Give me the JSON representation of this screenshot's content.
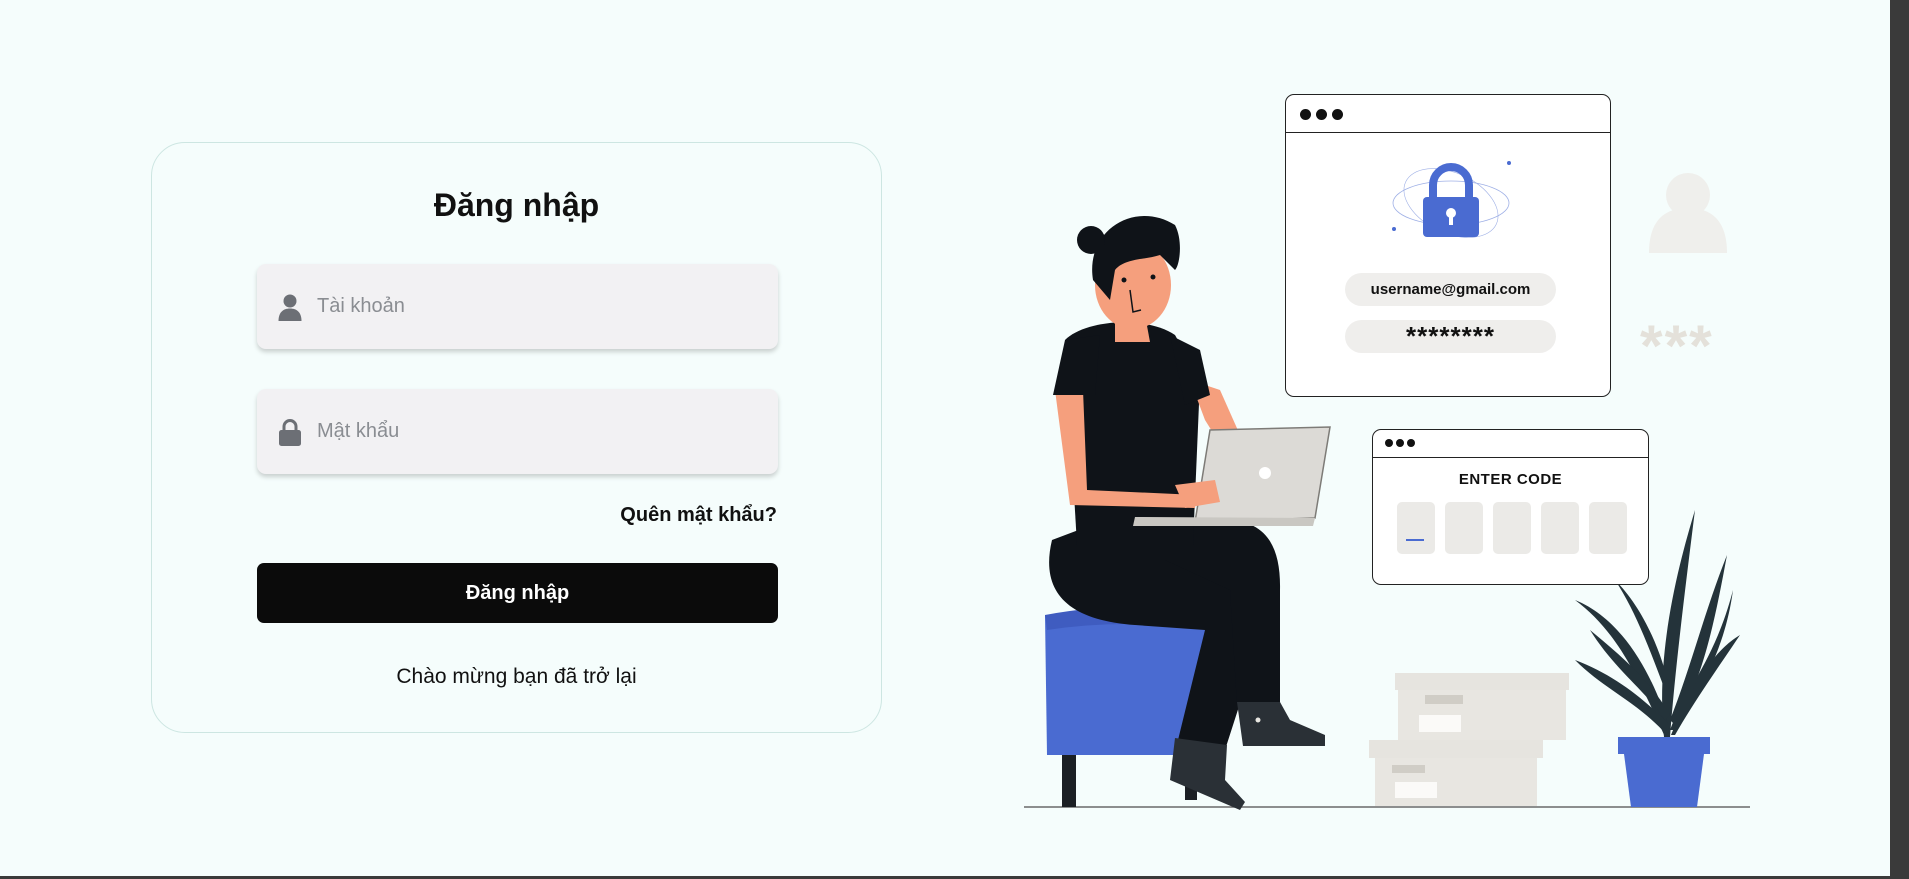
{
  "login": {
    "title": "Đăng nhập",
    "username_placeholder": "Tài khoản",
    "password_placeholder": "Mật khẩu",
    "forgot_password": "Quên mật khẩu?",
    "submit_label": "Đăng nhập",
    "welcome_text": "Chào mừng bạn đã trở lại"
  },
  "illustration": {
    "email_text": "username@gmail.com",
    "password_mask": "********",
    "enter_code_label": "ENTER CODE",
    "decor_stars": "***"
  },
  "colors": {
    "accent_blue": "#4a6bd1",
    "button_bg": "#0b0b0b",
    "field_bg": "#f2f1f3",
    "page_bg": "#f5fdfc"
  }
}
